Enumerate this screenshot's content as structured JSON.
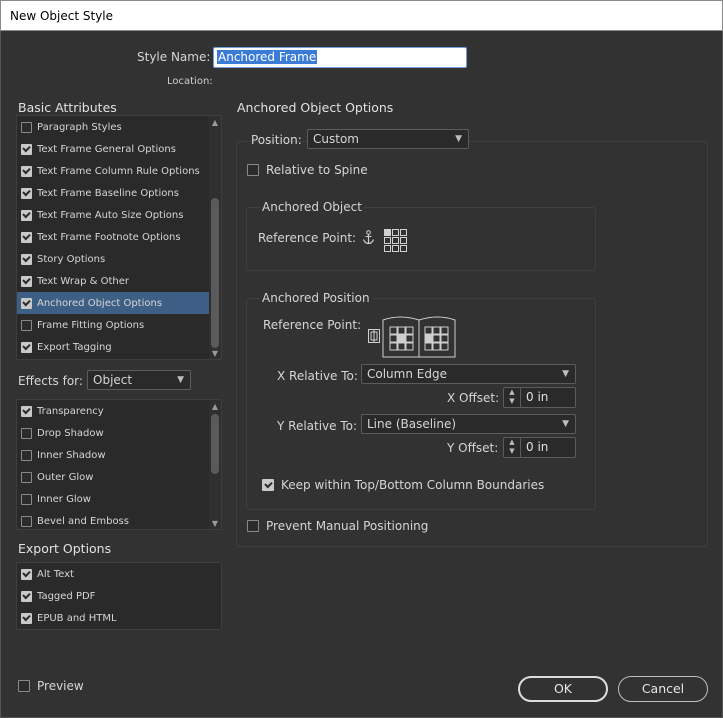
{
  "window": {
    "title": "New Object Style"
  },
  "style_name": {
    "label": "Style Name:",
    "value": "Anchored Frame"
  },
  "location": {
    "label": "Location:"
  },
  "basic_attributes": {
    "heading": "Basic Attributes",
    "items": [
      {
        "label": "Paragraph Styles",
        "checked": false,
        "selected": false
      },
      {
        "label": "Text Frame General Options",
        "checked": true,
        "selected": false
      },
      {
        "label": "Text Frame Column Rule Options",
        "checked": true,
        "selected": false
      },
      {
        "label": "Text Frame Baseline Options",
        "checked": true,
        "selected": false
      },
      {
        "label": "Text Frame Auto Size Options",
        "checked": true,
        "selected": false
      },
      {
        "label": "Text Frame Footnote Options",
        "checked": true,
        "selected": false
      },
      {
        "label": "Story Options",
        "checked": true,
        "selected": false
      },
      {
        "label": "Text Wrap & Other",
        "checked": true,
        "selected": false
      },
      {
        "label": "Anchored Object Options",
        "checked": true,
        "selected": true
      },
      {
        "label": "Frame Fitting Options",
        "checked": false,
        "selected": false
      },
      {
        "label": "Export Tagging",
        "checked": true,
        "selected": false
      }
    ]
  },
  "effects_for": {
    "label": "Effects for:",
    "value": "Object",
    "items": [
      {
        "label": "Transparency",
        "checked": true
      },
      {
        "label": "Drop Shadow",
        "checked": false
      },
      {
        "label": "Inner Shadow",
        "checked": false
      },
      {
        "label": "Outer Glow",
        "checked": false
      },
      {
        "label": "Inner Glow",
        "checked": false
      },
      {
        "label": "Bevel and Emboss",
        "checked": false
      }
    ]
  },
  "export_options": {
    "heading": "Export Options",
    "items": [
      {
        "label": "Alt Text",
        "checked": true
      },
      {
        "label": "Tagged PDF",
        "checked": true
      },
      {
        "label": "EPUB and HTML",
        "checked": true
      }
    ]
  },
  "preview": {
    "label": "Preview",
    "checked": false
  },
  "anchored_panel": {
    "heading": "Anchored Object Options",
    "position_label": "Position:",
    "position_value": "Custom",
    "relative_to_spine": {
      "label": "Relative to Spine",
      "checked": false
    },
    "anchored_object": {
      "heading": "Anchored Object",
      "reference_point_label": "Reference Point:",
      "anchor_icon": "anchor-icon"
    },
    "anchored_position": {
      "heading": "Anchored Position",
      "reference_point_label": "Reference Point:",
      "x_relative_label": "X Relative To:",
      "x_relative_value": "Column Edge",
      "x_offset_label": "X Offset:",
      "x_offset_value": "0 in",
      "y_relative_label": "Y Relative To:",
      "y_relative_value": "Line (Baseline)",
      "y_offset_label": "Y Offset:",
      "y_offset_value": "0 in",
      "keep_within": {
        "label": "Keep within Top/Bottom Column Boundaries",
        "checked": true
      }
    },
    "prevent_manual": {
      "label": "Prevent Manual Positioning",
      "checked": false
    }
  },
  "buttons": {
    "ok": "OK",
    "cancel": "Cancel"
  }
}
